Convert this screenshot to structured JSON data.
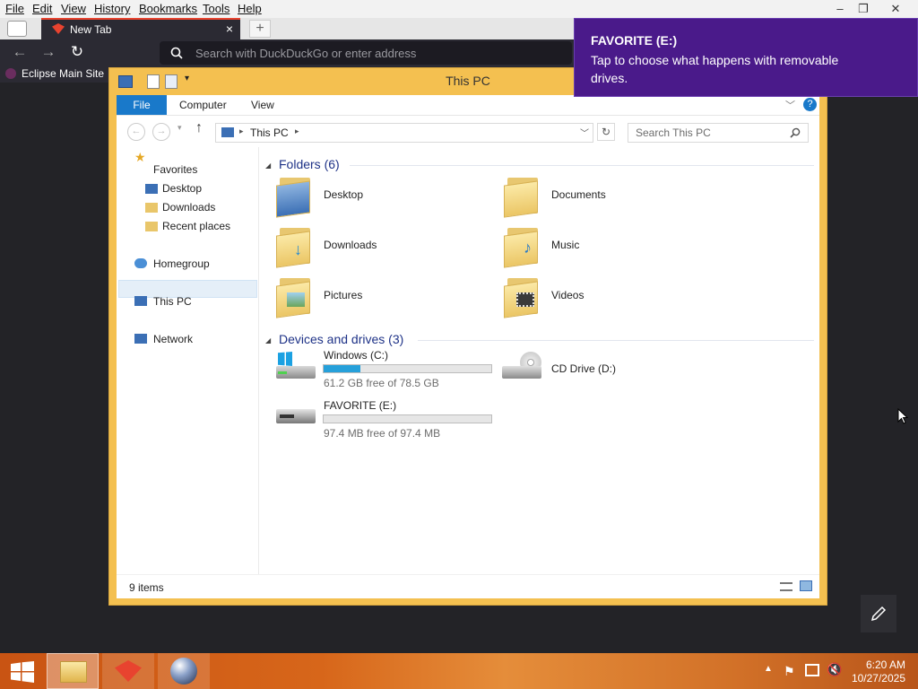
{
  "browser": {
    "menu": [
      "File",
      "Edit",
      "View",
      "History",
      "Bookmarks",
      "Tools",
      "Help"
    ],
    "tab_title": "New Tab",
    "address_placeholder": "Search with DuckDuckGo or enter address",
    "bookmark": "Eclipse Main Site"
  },
  "explorer": {
    "title": "This PC",
    "ribbon_tabs": [
      "File",
      "Computer",
      "View"
    ],
    "address_location": "This PC",
    "search_placeholder": "Search This PC",
    "nav": {
      "favorites": "Favorites",
      "favorites_items": [
        "Desktop",
        "Downloads",
        "Recent places"
      ],
      "homegroup": "Homegroup",
      "this_pc": "This PC",
      "network": "Network"
    },
    "folders_header": "Folders (6)",
    "folders": [
      "Desktop",
      "Documents",
      "Downloads",
      "Music",
      "Pictures",
      "Videos"
    ],
    "devices_header": "Devices and drives (3)",
    "drives": [
      {
        "name": "Windows (C:)",
        "free": "61.2 GB free of 78.5 GB",
        "used_fraction": 0.22
      },
      {
        "name": "CD Drive (D:)"
      },
      {
        "name": "FAVORITE (E:)",
        "free": "97.4 MB free of 97.4 MB",
        "used_fraction": 0.0
      }
    ],
    "status": "9 items"
  },
  "toast": {
    "title": "FAVORITE (E:)",
    "body": "Tap to choose what happens with removable drives."
  },
  "taskbar": {
    "time": "6:20 AM",
    "date": "10/27/2025"
  },
  "colors": {
    "accent": "#1979ca",
    "toast": "#4a1a8a",
    "drive_fill": "#26a0da"
  }
}
